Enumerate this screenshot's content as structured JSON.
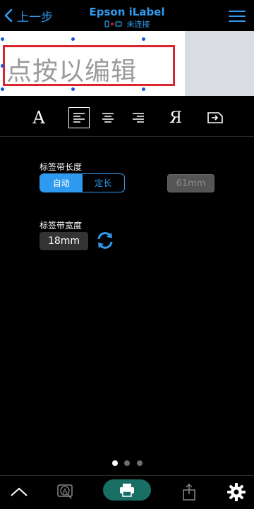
{
  "header": {
    "back_label": "上一步",
    "title": "Epson iLabel",
    "status": "未连接"
  },
  "editor": {
    "placeholder": "点按以编辑"
  },
  "toolbar": {
    "font_glyph": "A",
    "reverse_glyph": "Я"
  },
  "settings": {
    "tape_length_label": "标签带长度",
    "length_mode_auto": "自动",
    "length_mode_fixed": "定长",
    "length_value": "61mm",
    "tape_width_label": "标签带宽度",
    "width_value": "18mm"
  },
  "pager": {
    "count": 3,
    "active": 0
  },
  "colors": {
    "accent": "#2f9bf0",
    "selection": "#d9262e",
    "print": "#1a6f64"
  },
  "icons": [
    "chevron-left-icon",
    "menu-icon",
    "font-icon",
    "align-left-icon",
    "align-center-icon",
    "align-right-icon",
    "reverse-text-icon",
    "frame-icon",
    "refresh-icon",
    "chevron-up-icon",
    "preview-icon",
    "printer-icon",
    "share-icon",
    "gear-icon"
  ]
}
